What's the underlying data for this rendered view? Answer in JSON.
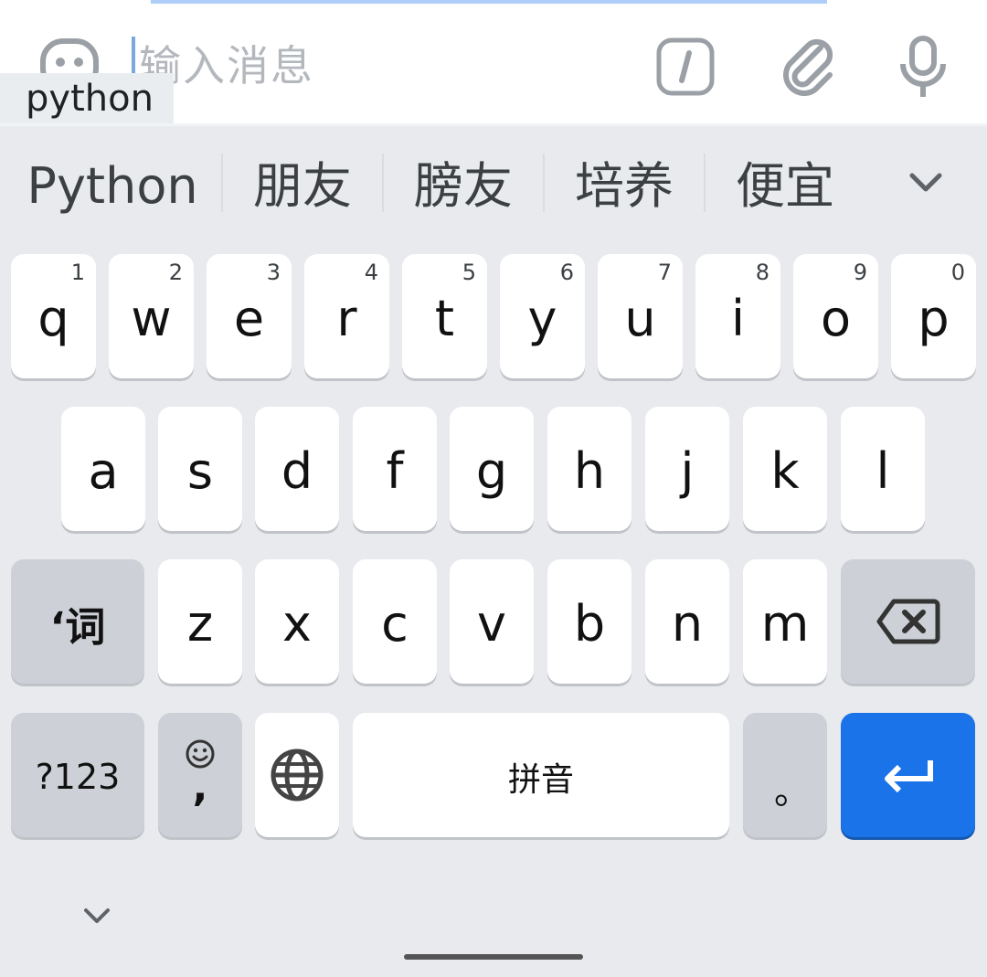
{
  "composer": {
    "placeholder": "输入消息",
    "composing_text": "python"
  },
  "candidates": [
    "Python",
    "朋友",
    "膀友",
    "培养",
    "便宜"
  ],
  "keyboard": {
    "row1": [
      {
        "key": "q",
        "hint": "1"
      },
      {
        "key": "w",
        "hint": "2"
      },
      {
        "key": "e",
        "hint": "3"
      },
      {
        "key": "r",
        "hint": "4"
      },
      {
        "key": "t",
        "hint": "5"
      },
      {
        "key": "y",
        "hint": "6"
      },
      {
        "key": "u",
        "hint": "7"
      },
      {
        "key": "i",
        "hint": "8"
      },
      {
        "key": "o",
        "hint": "9"
      },
      {
        "key": "p",
        "hint": "0"
      }
    ],
    "row2": [
      "a",
      "s",
      "d",
      "f",
      "g",
      "h",
      "j",
      "k",
      "l"
    ],
    "row3_mode": "‘词",
    "row3": [
      "z",
      "x",
      "c",
      "v",
      "b",
      "n",
      "m"
    ],
    "numbers": "?123",
    "emoji_comma": ",",
    "space": "拼音",
    "period": "。"
  },
  "colors": {
    "accent": "#1a73e8",
    "keyboard_bg": "#e8eaed",
    "key_bg": "#ffffff",
    "func_key_bg": "#cdd0d6"
  },
  "icons": [
    "emoji-icon",
    "slash-command-icon",
    "paperclip-icon",
    "microphone-icon",
    "chevron-down-icon",
    "backspace-icon",
    "smiley-icon",
    "globe-icon",
    "enter-icon",
    "collapse-keyboard-icon"
  ]
}
